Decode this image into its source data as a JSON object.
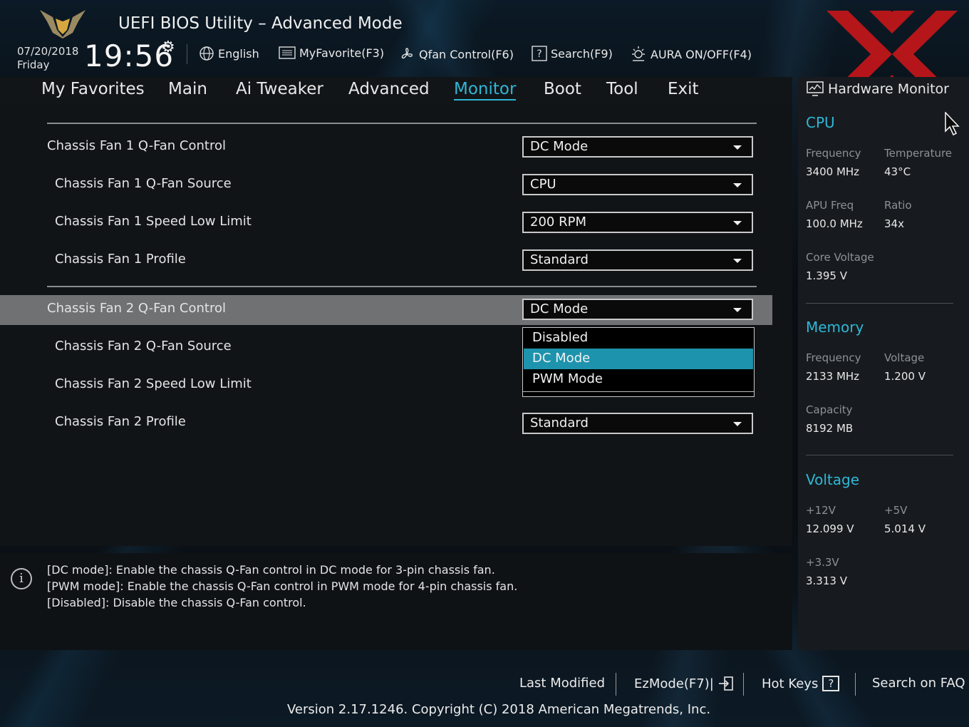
{
  "header": {
    "title": "UEFI BIOS Utility – Advanced Mode",
    "date": "07/20/2018",
    "day": "Friday",
    "time": "19:56",
    "tools": {
      "language": "English",
      "favorite": "MyFavorite(F3)",
      "qfan": "Qfan Control(F6)",
      "search": "Search(F9)",
      "aura": "AURA ON/OFF(F4)"
    }
  },
  "nav": {
    "tabs": [
      "My Favorites",
      "Main",
      "Ai Tweaker",
      "Advanced",
      "Monitor",
      "Boot",
      "Tool",
      "Exit"
    ],
    "active": "Monitor"
  },
  "settings": [
    {
      "label": "Chassis Fan 1 Q-Fan Control",
      "value": "DC Mode"
    },
    {
      "label": "Chassis Fan 1 Q-Fan Source",
      "value": "CPU"
    },
    {
      "label": "Chassis Fan 1 Speed Low Limit",
      "value": "200 RPM"
    },
    {
      "label": "Chassis Fan 1 Profile",
      "value": "Standard"
    },
    {
      "label": "Chassis Fan 2 Q-Fan Control",
      "value": "DC Mode"
    },
    {
      "label": "Chassis Fan 2 Q-Fan Source",
      "value": ""
    },
    {
      "label": "Chassis Fan 2 Speed Low Limit",
      "value": ""
    },
    {
      "label": "Chassis Fan 2 Profile",
      "value": "Standard"
    }
  ],
  "dropdown": {
    "options": [
      "Disabled",
      "DC Mode",
      "PWM Mode"
    ],
    "selected": "DC Mode"
  },
  "help": {
    "lines": [
      "[DC mode]: Enable the chassis Q-Fan control in DC mode for 3-pin chassis fan.",
      "[PWM mode]: Enable the chassis Q-Fan control in PWM mode for 4-pin chassis fan.",
      "[Disabled]: Disable the chassis Q-Fan control."
    ]
  },
  "hw_monitor": {
    "title": "Hardware Monitor",
    "cpu": {
      "heading": "CPU",
      "frequency_label": "Frequency",
      "frequency": "3400 MHz",
      "temperature_label": "Temperature",
      "temperature": "43°C",
      "apu_label": "APU Freq",
      "apu": "100.0 MHz",
      "ratio_label": "Ratio",
      "ratio": "34x",
      "core_voltage_label": "Core Voltage",
      "core_voltage": "1.395 V"
    },
    "memory": {
      "heading": "Memory",
      "frequency_label": "Frequency",
      "frequency": "2133 MHz",
      "voltage_label": "Voltage",
      "voltage": "1.200 V",
      "capacity_label": "Capacity",
      "capacity": "8192 MB"
    },
    "voltage": {
      "heading": "Voltage",
      "v12_label": "+12V",
      "v12": "12.099 V",
      "v5_label": "+5V",
      "v5": "5.014 V",
      "v33_label": "+3.3V",
      "v33": "3.313 V"
    }
  },
  "footer": {
    "last_modified": "Last Modified",
    "ezmode": "EzMode(F7)|",
    "hotkeys": "Hot Keys",
    "hotkeys_key": "?",
    "faq": "Search on FAQ",
    "version": "Version 2.17.1246. Copyright (C) 2018 American Megatrends, Inc."
  },
  "colors": {
    "accent": "#2fb7d6",
    "selection": "#1d93ad",
    "watermark": "#d01818"
  }
}
